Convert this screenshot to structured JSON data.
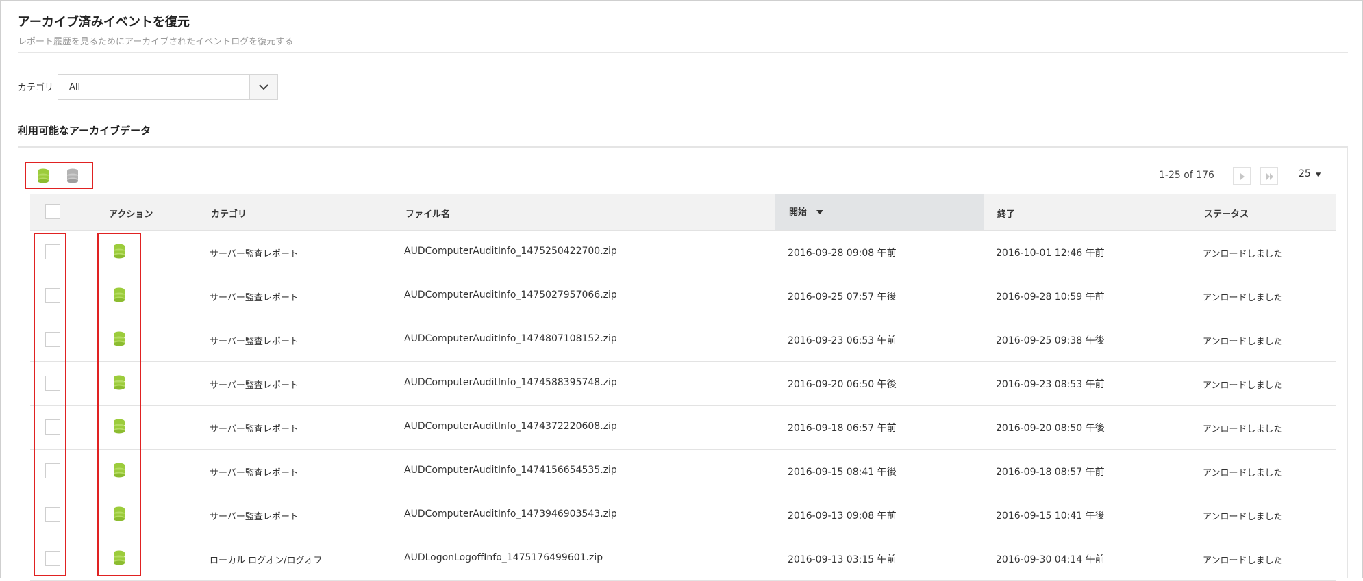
{
  "page": {
    "title": "アーカイブ済みイベントを復元",
    "subtitle": "レポート履歴を見るためにアーカイブされたイベントログを復元する"
  },
  "filter": {
    "category_label": "カテゴリ",
    "category_value": "All"
  },
  "section_title": "利用可能なアーカイブデータ",
  "pager": {
    "range_text": "1-25 of 176",
    "page_size": "25"
  },
  "table": {
    "columns": {
      "action": "アクション",
      "category": "カテゴリ",
      "filename": "ファイル名",
      "start": "開始",
      "end": "終了",
      "status": "ステータス"
    },
    "rows": [
      {
        "category": "サーバー監査レポート",
        "filename": "AUDComputerAuditInfo_1475250422700.zip",
        "start": "2016-09-28 09:08 午前",
        "end": "2016-10-01 12:46 午前",
        "status": "アンロードしました"
      },
      {
        "category": "サーバー監査レポート",
        "filename": "AUDComputerAuditInfo_1475027957066.zip",
        "start": "2016-09-25 07:57 午後",
        "end": "2016-09-28 10:59 午前",
        "status": "アンロードしました"
      },
      {
        "category": "サーバー監査レポート",
        "filename": "AUDComputerAuditInfo_1474807108152.zip",
        "start": "2016-09-23 06:53 午前",
        "end": "2016-09-25 09:38 午後",
        "status": "アンロードしました"
      },
      {
        "category": "サーバー監査レポート",
        "filename": "AUDComputerAuditInfo_1474588395748.zip",
        "start": "2016-09-20 06:50 午後",
        "end": "2016-09-23 08:53 午前",
        "status": "アンロードしました"
      },
      {
        "category": "サーバー監査レポート",
        "filename": "AUDComputerAuditInfo_1474372220608.zip",
        "start": "2016-09-18 06:57 午前",
        "end": "2016-09-20 08:50 午後",
        "status": "アンロードしました"
      },
      {
        "category": "サーバー監査レポート",
        "filename": "AUDComputerAuditInfo_1474156654535.zip",
        "start": "2016-09-15 08:41 午後",
        "end": "2016-09-18 08:57 午前",
        "status": "アンロードしました"
      },
      {
        "category": "サーバー監査レポート",
        "filename": "AUDComputerAuditInfo_1473946903543.zip",
        "start": "2016-09-13 09:08 午前",
        "end": "2016-09-15 10:41 午後",
        "status": "アンロードしました"
      },
      {
        "category": "ローカル ログオン/ログオフ",
        "filename": "AUDLogonLogoffInfo_1475176499601.zip",
        "start": "2016-09-13 03:15 午前",
        "end": "2016-09-30 04:14 午前",
        "status": "アンロードしました"
      }
    ]
  },
  "icons": {
    "restore_color": "#9ccc3c",
    "disabled_color": "#b3b3b3",
    "highlight_color": "#e02222"
  }
}
